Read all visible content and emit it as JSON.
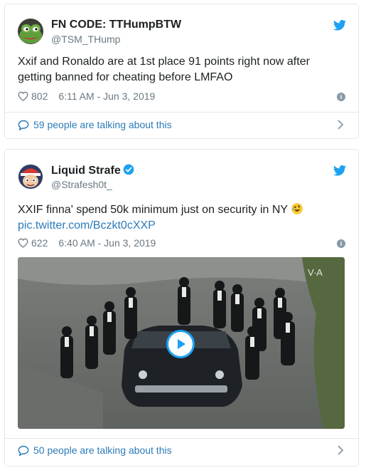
{
  "tweets": [
    {
      "author_name": "FN CODE: TTHumpBTW",
      "handle": "@TSM_THump",
      "text": "Xxif and Ronaldo are at 1st place 91 points right now after getting banned for cheating before LMFAO",
      "likes": "802",
      "timestamp": "6:11 AM - Jun 3, 2019",
      "talking": "59 people are talking about this",
      "avatar": "pepe-frog-avatar",
      "verified": false
    },
    {
      "author_name": "Liquid Strafe",
      "handle": "@Strafesh0t_",
      "text": "XXIF finna' spend 50k minimum just on security in NY",
      "link": "pic.twitter.com/Bczkt0cXXP",
      "likes": "622",
      "timestamp": "6:40 AM - Jun 3, 2019",
      "talking": "50 people are talking about this",
      "avatar": "cartoon-character-avatar",
      "verified": true,
      "emoji": "rolling-on-floor-laughing-emoji",
      "media": "video-thumbnail-bodyguards-running-beside-car"
    }
  ],
  "colors": {
    "twitter_blue": "#1da1f2",
    "link_blue": "#2b7bb9",
    "text": "#1c2022",
    "muted": "#697882",
    "border": "#e1e8ed"
  },
  "media_watermark": "V∙A"
}
